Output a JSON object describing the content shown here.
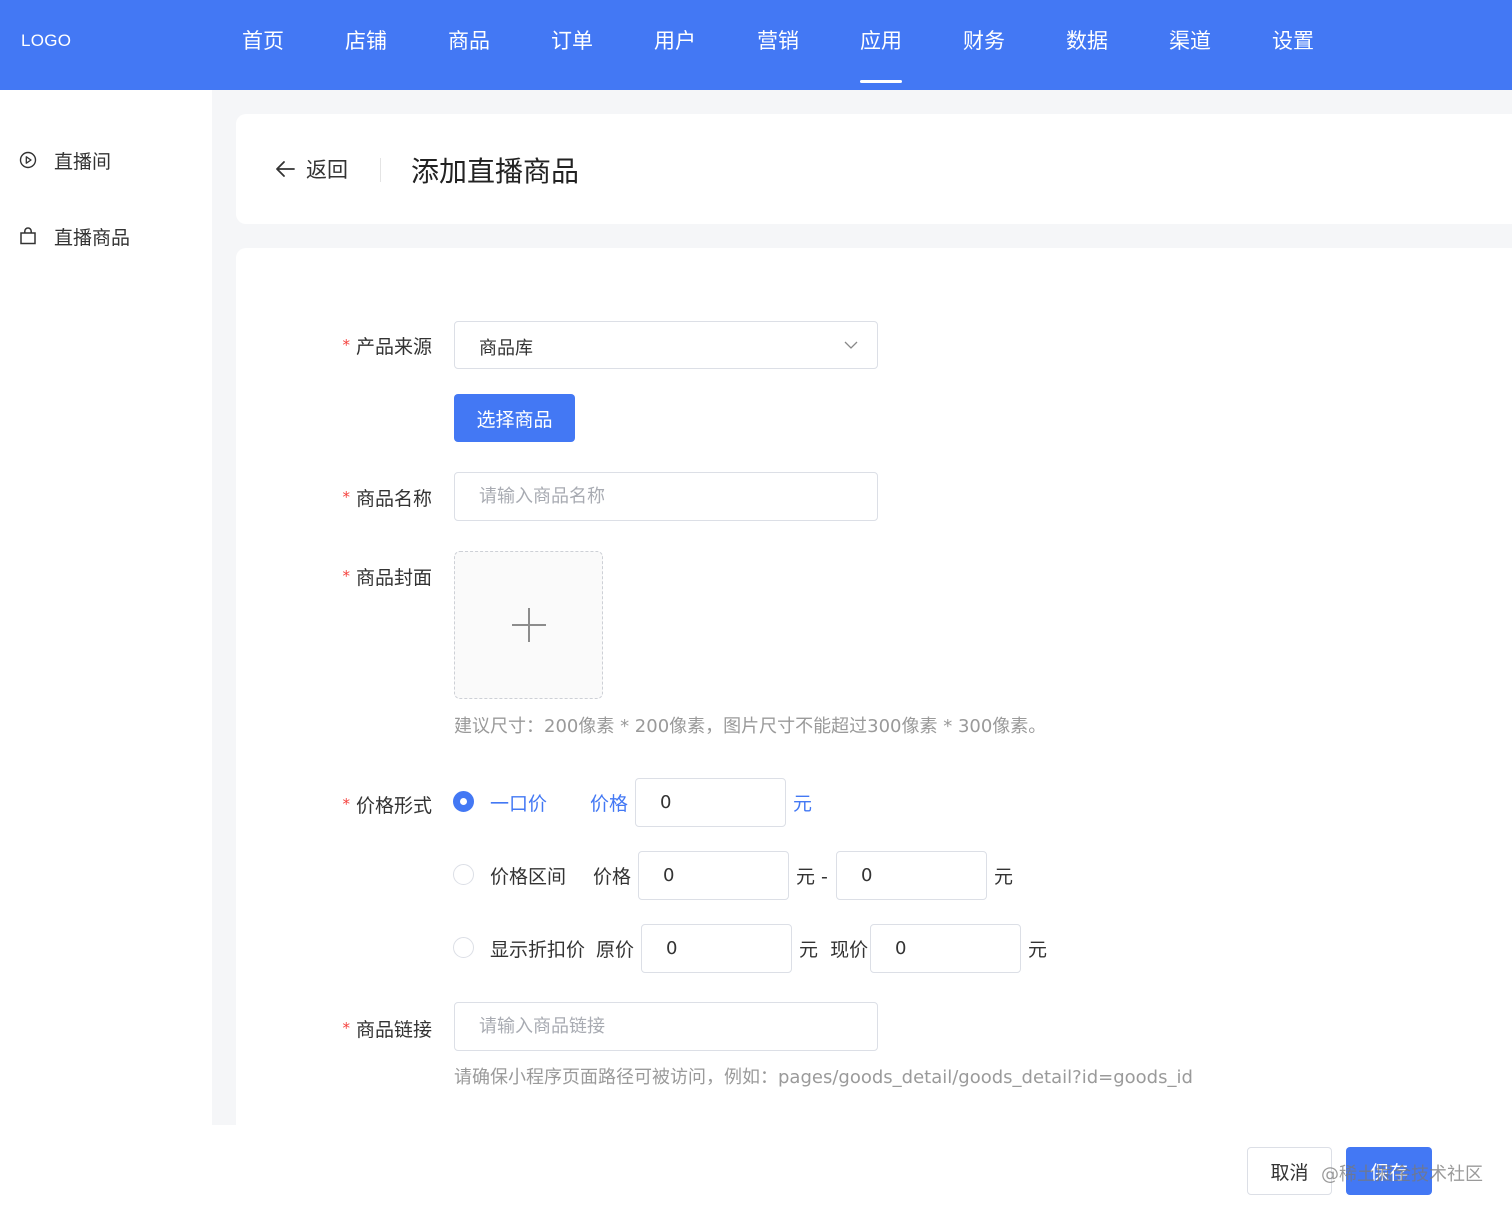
{
  "header": {
    "logo": "LOGO",
    "nav": [
      {
        "label": "首页"
      },
      {
        "label": "店铺"
      },
      {
        "label": "商品"
      },
      {
        "label": "订单"
      },
      {
        "label": "用户"
      },
      {
        "label": "营销"
      },
      {
        "label": "应用",
        "active": true
      },
      {
        "label": "财务"
      },
      {
        "label": "数据"
      },
      {
        "label": "渠道"
      },
      {
        "label": "设置"
      }
    ]
  },
  "sidebar": {
    "items": [
      {
        "label": "直播间",
        "icon": "play-circle-icon"
      },
      {
        "label": "直播商品",
        "icon": "shopping-bag-icon"
      }
    ]
  },
  "page": {
    "back_label": "返回",
    "title": "添加直播商品"
  },
  "form": {
    "required_mark": "*",
    "source": {
      "label": "产品来源",
      "value": "商品库"
    },
    "select_goods_button": "选择商品",
    "name": {
      "label": "商品名称",
      "placeholder": "请输入商品名称",
      "value": ""
    },
    "cover": {
      "label": "商品封面",
      "hint": "建议尺寸：200像素 * 200像素，图片尺寸不能超过300像素 * 300像素。"
    },
    "price": {
      "label": "价格形式",
      "fixed": {
        "option": "一口价",
        "selected": true,
        "price_label": "价格",
        "value": "0",
        "unit": "元"
      },
      "range": {
        "option": "价格区间",
        "selected": false,
        "price_label": "价格",
        "min_value": "0",
        "sep": "元 -",
        "max_value": "0",
        "unit": "元"
      },
      "discount": {
        "option": "显示折扣价",
        "selected": false,
        "original_label": "原价",
        "original_value": "0",
        "sep": "元  现价",
        "current_value": "0",
        "unit": "元"
      }
    },
    "link": {
      "label": "商品链接",
      "placeholder": "请输入商品链接",
      "value": "",
      "hint": "请确保小程序页面路径可被访问，例如：pages/goods_detail/goods_detail?id=goods_id"
    }
  },
  "footer": {
    "cancel": "取消",
    "save": "保存",
    "watermark": "@稀土掘金技术社区"
  },
  "colors": {
    "primary": "#4378f4",
    "required": "#f5413d",
    "hint": "#9a9a9a"
  }
}
